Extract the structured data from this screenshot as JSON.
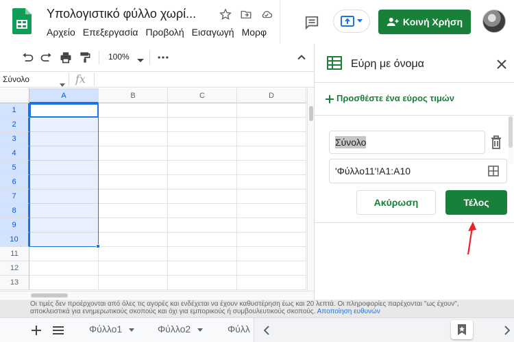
{
  "header": {
    "title": "Υπολογιστικό φύλλο χωρί...",
    "menu": [
      "Αρχείο",
      "Επεξεργασία",
      "Προβολή",
      "Εισαγωγή",
      "Μορφ"
    ],
    "share_label": "Κοινή Χρήση"
  },
  "toolbar": {
    "zoom": "100%"
  },
  "formula_bar": {
    "name_box": "Σύνολο",
    "fx": "fx"
  },
  "grid": {
    "columns": [
      "A",
      "B",
      "C",
      "D"
    ],
    "rows": [
      "1",
      "2",
      "3",
      "4",
      "5",
      "6",
      "7",
      "8",
      "9",
      "10",
      "11",
      "12",
      "13"
    ]
  },
  "panel": {
    "title": "Εύρη με όνομα",
    "add_range": "Προσθέστε ένα εύρος τιμών",
    "range_name": "Σύνολο",
    "range_ref": "'Φύλλο11'!A1:A10",
    "cancel_label": "Ακύρωση",
    "done_label": "Τέλος"
  },
  "disclaimer": {
    "text": "Οι τιμές δεν προέρχονται από όλες τις αγορές και ενδέχεται να έχουν καθυστέρηση έως και 20 λεπτά. Οι πληροφορίες παρέχονται \"ως έχουν\", αποκλειστικά για ενημερωτικούς σκοπούς και όχι για εμπορικούς ή συμβουλευτικούς σκοπούς.",
    "link": "Αποποίηση ευθυνών"
  },
  "sheets": {
    "tabs": [
      "Φύλλο1",
      "Φύλλο2",
      "Φύλλ"
    ]
  },
  "colors": {
    "accent_green": "#188038",
    "selection_blue": "#1a73e8",
    "annotation_red": "#e8212a"
  }
}
